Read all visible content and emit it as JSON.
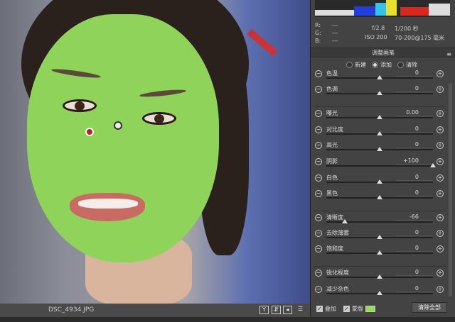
{
  "photo": {
    "filename": "DSC_4934.JPG",
    "view_buttons": [
      "Y",
      "⇵",
      "◂",
      "☰"
    ]
  },
  "histogram_colors": [
    "#ddd",
    "#1f3fd8",
    "#37c0e8",
    "#e8e02f",
    "#d8281e"
  ],
  "info": {
    "r_label": "R:",
    "g_label": "G:",
    "b_label": "B:",
    "r": "---",
    "g": "---",
    "b": "---",
    "aperture": "f/2.8",
    "shutter": "1/200 秒",
    "iso": "ISO 200",
    "lens": "70-200@175 毫米"
  },
  "panel": {
    "title": "调整画笔",
    "menu_icon": "≡",
    "modes": [
      {
        "label": "新建",
        "selected": false
      },
      {
        "label": "添加",
        "selected": true
      },
      {
        "label": "清除",
        "selected": false
      }
    ]
  },
  "sliders": [
    {
      "label": "色温",
      "value": "0",
      "pos": 0
    },
    {
      "label": "色调",
      "value": "0",
      "pos": 0
    },
    {
      "label": "曝光",
      "value": "0.00",
      "pos": 0
    },
    {
      "label": "对比度",
      "value": "0",
      "pos": 0
    },
    {
      "label": "高光",
      "value": "0",
      "pos": 0
    },
    {
      "label": "阴影",
      "value": "+100",
      "pos": 100
    },
    {
      "label": "白色",
      "value": "0",
      "pos": 0
    },
    {
      "label": "黑色",
      "value": "0",
      "pos": 0
    },
    {
      "label": "清晰度",
      "value": "-66",
      "pos": -66
    },
    {
      "label": "去除薄雾",
      "value": "0",
      "pos": 0
    },
    {
      "label": "饱和度",
      "value": "0",
      "pos": 0
    },
    {
      "label": "锐化程度",
      "value": "0",
      "pos": 0
    },
    {
      "label": "减少杂色",
      "value": "0",
      "pos": 0
    }
  ],
  "footer": {
    "overlay_label": "叠加",
    "overlay_checked": true,
    "mask_label": "蒙版",
    "mask_checked": true,
    "mask_color": "#8ee04a",
    "clear_all": "清除全部"
  }
}
